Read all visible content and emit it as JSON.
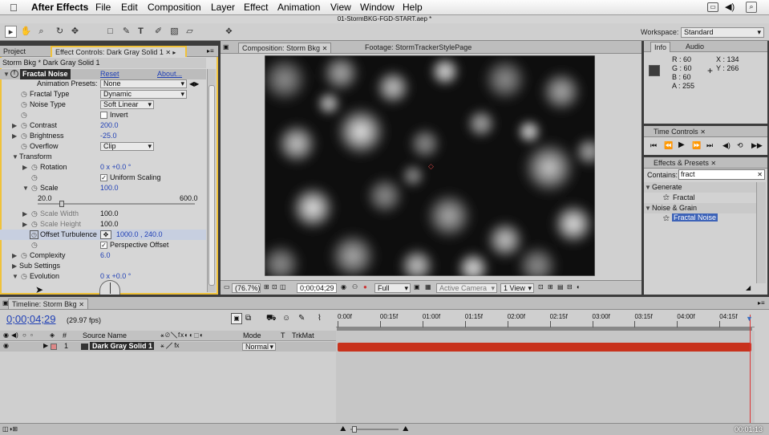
{
  "menubar": {
    "apple": "",
    "app": "After Effects",
    "items": [
      "File",
      "Edit",
      "Composition",
      "Layer",
      "Effect",
      "Animation",
      "View",
      "Window",
      "Help"
    ]
  },
  "title": "01-StormBKG-FGD-START.aep *",
  "workspace": {
    "label": "Workspace:",
    "value": "Standard"
  },
  "tools": [
    "▸",
    "✋",
    "⌕",
    "↻",
    "✥",
    "□",
    "✎",
    "T",
    "✐",
    "▧",
    "▱"
  ],
  "left": {
    "tabs": [
      "Project",
      "Effect Controls: Dark Gray Solid 1"
    ],
    "subtitle": "Storm Bkg * Dark Gray Solid 1",
    "effect_name": "Fractal Noise",
    "reset": "Reset",
    "about": "About...",
    "presets_label": "Animation Presets:",
    "presets_value": "None",
    "rows": {
      "fractal_type": "Fractal Type",
      "fractal_type_val": "Dynamic",
      "noise_type": "Noise Type",
      "noise_type_val": "Soft Linear",
      "invert": "Invert",
      "contrast": "Contrast",
      "contrast_val": "200.0",
      "brightness": "Brightness",
      "brightness_val": "-25.0",
      "overflow": "Overflow",
      "overflow_val": "Clip",
      "transform": "Transform",
      "rotation": "Rotation",
      "rotation_val": "0 x +0.0 °",
      "uniform": "Uniform Scaling",
      "scale": "Scale",
      "scale_val": "100.0",
      "scale_min": "20.0",
      "scale_max": "600.0",
      "scale_slider": 0.14,
      "scale_width": "Scale Width",
      "scale_width_val": "100.0",
      "scale_height": "Scale Height",
      "scale_height_val": "100.0",
      "offset": "Offset Turbulence",
      "offset_val": "1000.0 , 240.0",
      "perspective": "Perspective Offset",
      "complexity": "Complexity",
      "complexity_val": "6.0",
      "sub_settings": "Sub Settings",
      "evolution": "Evolution",
      "evolution_val": "0 x +0.0 °"
    }
  },
  "comp": {
    "tabs": [
      "Composition: Storm Bkg",
      "Footage: StormTrackerStylePage"
    ],
    "zoom": "(76.7%)",
    "timecode": "0;00;04;29",
    "resolution": "Full",
    "camera": "Active Camera",
    "views": "1 View"
  },
  "info": {
    "tabs": [
      "Info",
      "Audio"
    ],
    "r": "R : 60",
    "g": "G : 60",
    "b": "B : 60",
    "a": "A : 255",
    "x": "X : 134",
    "y": "Y : 266",
    "swatch": "#3c3c3c"
  },
  "time_controls": {
    "tab": "Time Controls"
  },
  "effects_presets": {
    "tab": "Effects & Presets",
    "contains_label": "Contains:",
    "contains_value": "fract",
    "tree": [
      {
        "label": "Generate",
        "indent": 0
      },
      {
        "label": "Fractal",
        "indent": 1
      },
      {
        "label": "Noise & Grain",
        "indent": 0
      },
      {
        "label": "Fractal Noise",
        "indent": 1,
        "selected": true
      }
    ]
  },
  "timeline": {
    "tab": "Timeline: Storm Bkg",
    "timecode": "0;00;04;29",
    "fps": "(29.97 fps)",
    "ruler": [
      "0:00f",
      "00:15f",
      "01:00f",
      "01:15f",
      "02:00f",
      "02:15f",
      "03:00f",
      "03:15f",
      "04:00f",
      "04:15f"
    ],
    "headers": {
      "num": "#",
      "source": "Source Name",
      "mode": "Mode",
      "t": "T",
      "trkmat": "TrkMat"
    },
    "layer": {
      "num": "1",
      "name": "Dark Gray Solid 1",
      "mode": "Normal"
    },
    "corner_timecode": "00:01:13"
  },
  "colors": {
    "bar": "#c8321c",
    "selection": "#f0c23a"
  }
}
